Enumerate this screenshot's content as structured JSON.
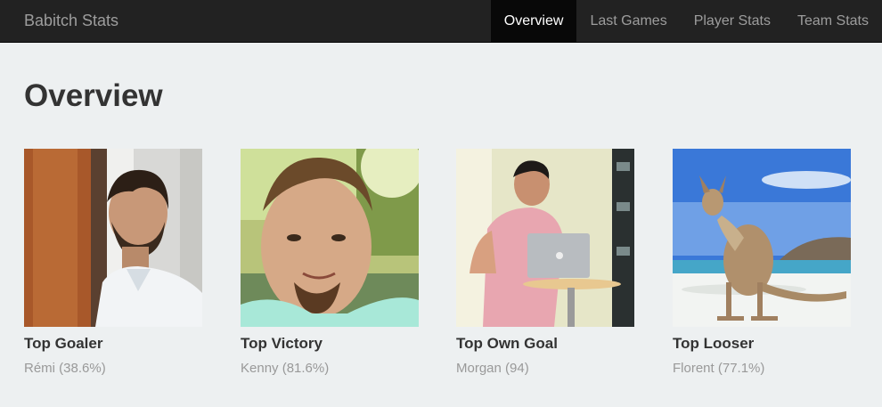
{
  "app": {
    "brand": "Babitch Stats"
  },
  "nav": {
    "items": [
      {
        "label": "Overview",
        "active": true
      },
      {
        "label": "Last Games",
        "active": false
      },
      {
        "label": "Player Stats",
        "active": false
      },
      {
        "label": "Team Stats",
        "active": false
      }
    ]
  },
  "page": {
    "title": "Overview"
  },
  "cards": [
    {
      "title": "Top Goaler",
      "subtitle": "Rémi (38.6%)",
      "photo": "man-with-beard-leaning-on-door"
    },
    {
      "title": "Top Victory",
      "subtitle": "Kenny (81.6%)",
      "photo": "smiling-man-closeup"
    },
    {
      "title": "Top Own Goal",
      "subtitle": "Morgan (94)",
      "photo": "man-presenting-at-laptop"
    },
    {
      "title": "Top Looser",
      "subtitle": "Florent (77.1%)",
      "photo": "kangaroo-on-beach"
    }
  ],
  "colors": {
    "navbar": "#222222",
    "nav_active": "#080808",
    "background": "#edf0f1"
  }
}
